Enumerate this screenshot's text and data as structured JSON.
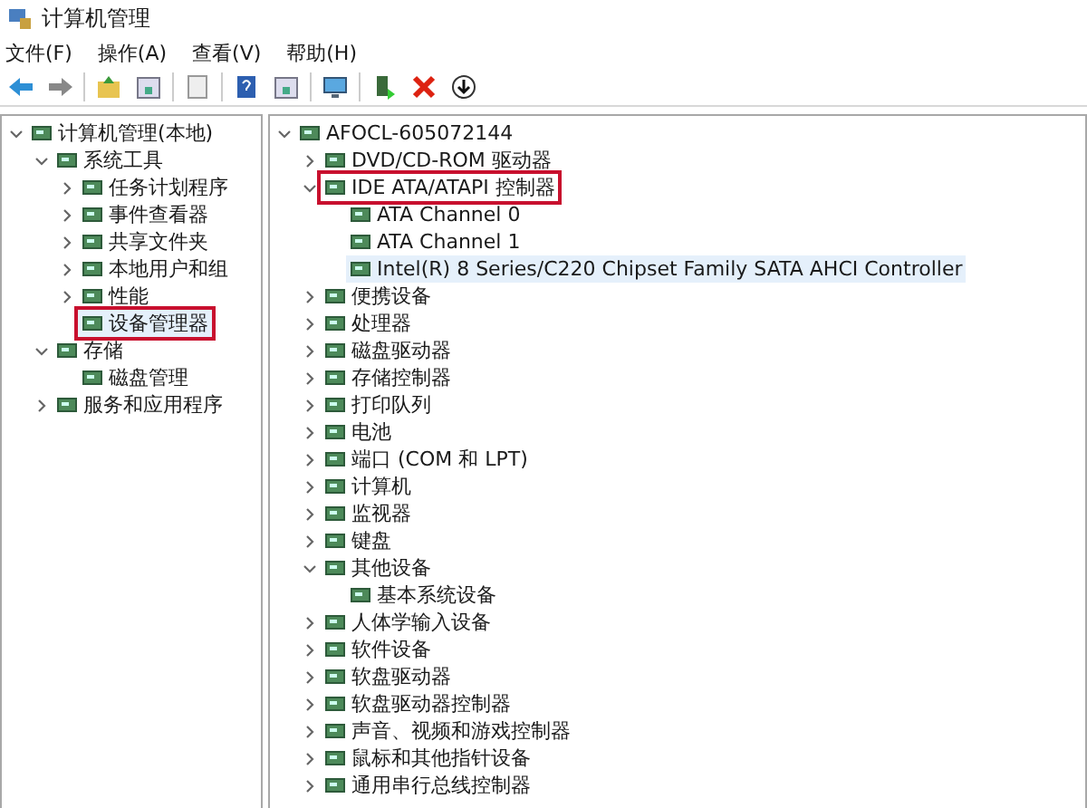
{
  "window": {
    "title": "计算机管理"
  },
  "menu": [
    "文件(F)",
    "操作(A)",
    "查看(V)",
    "帮助(H)"
  ],
  "left_tree": [
    {
      "label": "计算机管理(本地)",
      "expanded": true,
      "selected": false,
      "highlighted": false,
      "children": [
        {
          "label": "系统工具",
          "expanded": true,
          "selected": false,
          "highlighted": false,
          "children": [
            {
              "label": "任务计划程序",
              "expanded": false,
              "selected": false,
              "highlighted": false
            },
            {
              "label": "事件查看器",
              "expanded": false,
              "selected": false,
              "highlighted": false
            },
            {
              "label": "共享文件夹",
              "expanded": false,
              "selected": false,
              "highlighted": false
            },
            {
              "label": "本地用户和组",
              "expanded": false,
              "selected": false,
              "highlighted": false
            },
            {
              "label": "性能",
              "expanded": false,
              "selected": false,
              "highlighted": false
            },
            {
              "label": "设备管理器",
              "selected": true,
              "highlighted": true
            }
          ]
        },
        {
          "label": "存储",
          "expanded": true,
          "selected": false,
          "highlighted": false,
          "children": [
            {
              "label": "磁盘管理",
              "selected": false,
              "highlighted": false
            }
          ]
        },
        {
          "label": "服务和应用程序",
          "expanded": false,
          "selected": false,
          "highlighted": false
        }
      ]
    }
  ],
  "device_tree": [
    {
      "label": "AFOCL-605072144",
      "expanded": true,
      "selected": false,
      "highlighted": false,
      "children": [
        {
          "label": "DVD/CD-ROM 驱动器",
          "expanded": false,
          "selected": false,
          "highlighted": false
        },
        {
          "label": "IDE ATA/ATAPI 控制器",
          "expanded": true,
          "selected": false,
          "highlighted": true,
          "children": [
            {
              "label": "ATA Channel 0",
              "selected": false,
              "highlighted": false
            },
            {
              "label": "ATA Channel 1",
              "selected": false,
              "highlighted": false
            },
            {
              "label": "Intel(R) 8 Series/C220 Chipset Family SATA AHCI Controller",
              "selected": true,
              "highlighted": false
            }
          ]
        },
        {
          "label": "便携设备",
          "expanded": false,
          "selected": false,
          "highlighted": false
        },
        {
          "label": "处理器",
          "expanded": false,
          "selected": false,
          "highlighted": false
        },
        {
          "label": "磁盘驱动器",
          "expanded": false,
          "selected": false,
          "highlighted": false
        },
        {
          "label": "存储控制器",
          "expanded": false,
          "selected": false,
          "highlighted": false
        },
        {
          "label": "打印队列",
          "expanded": false,
          "selected": false,
          "highlighted": false
        },
        {
          "label": "电池",
          "expanded": false,
          "selected": false,
          "highlighted": false
        },
        {
          "label": "端口 (COM 和 LPT)",
          "expanded": false,
          "selected": false,
          "highlighted": false
        },
        {
          "label": "计算机",
          "expanded": false,
          "selected": false,
          "highlighted": false
        },
        {
          "label": "监视器",
          "expanded": false,
          "selected": false,
          "highlighted": false
        },
        {
          "label": "键盘",
          "expanded": false,
          "selected": false,
          "highlighted": false
        },
        {
          "label": "其他设备",
          "expanded": true,
          "selected": false,
          "highlighted": false,
          "children": [
            {
              "label": "基本系统设备",
              "selected": false,
              "highlighted": false
            }
          ]
        },
        {
          "label": "人体学输入设备",
          "expanded": false,
          "selected": false,
          "highlighted": false
        },
        {
          "label": "软件设备",
          "expanded": false,
          "selected": false,
          "highlighted": false
        },
        {
          "label": "软盘驱动器",
          "expanded": false,
          "selected": false,
          "highlighted": false
        },
        {
          "label": "软盘驱动器控制器",
          "expanded": false,
          "selected": false,
          "highlighted": false
        },
        {
          "label": "声音、视频和游戏控制器",
          "expanded": false,
          "selected": false,
          "highlighted": false
        },
        {
          "label": "鼠标和其他指针设备",
          "expanded": false,
          "selected": false,
          "highlighted": false
        },
        {
          "label": "通用串行总线控制器",
          "expanded": false,
          "selected": false,
          "highlighted": false
        }
      ]
    }
  ]
}
